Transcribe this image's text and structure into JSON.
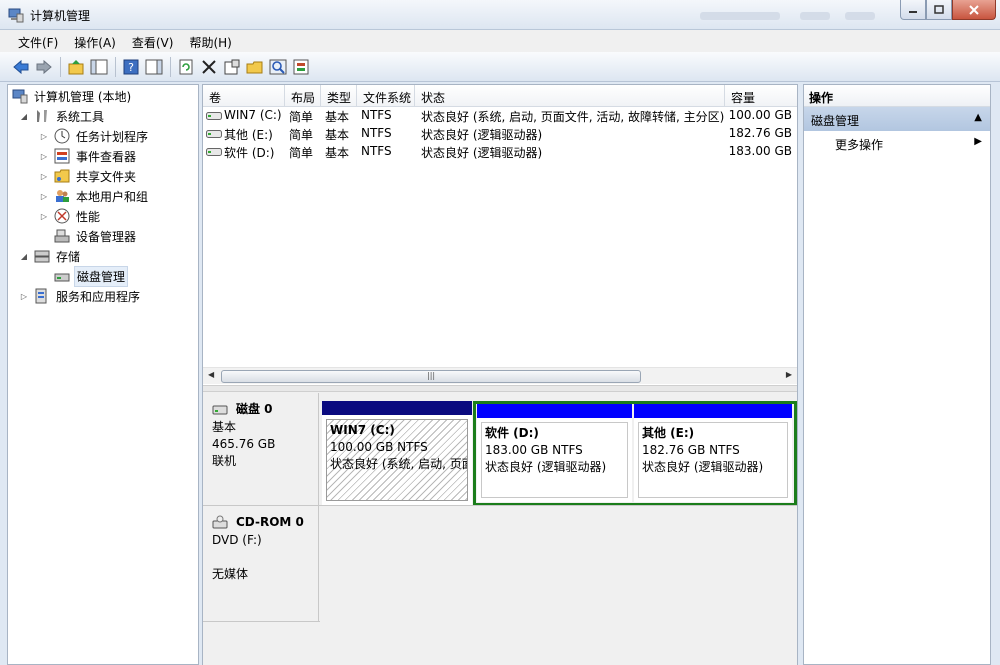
{
  "window": {
    "title": "计算机管理"
  },
  "menu": [
    "文件(F)",
    "操作(A)",
    "查看(V)",
    "帮助(H)"
  ],
  "toolbar": [
    "back-icon",
    "forward-icon",
    "up-folder-icon",
    "show-hide-tree-icon",
    "help-icon",
    "show-hide-action-icon",
    "refresh-icon",
    "delete-icon",
    "properties-icon",
    "open-icon",
    "search-icon",
    "settings-icon"
  ],
  "tree": {
    "root": "计算机管理 (本地)",
    "system_tools": "系统工具",
    "task_scheduler": "任务计划程序",
    "event_viewer": "事件查看器",
    "shared_folders": "共享文件夹",
    "local_users": "本地用户和组",
    "performance": "性能",
    "device_manager": "设备管理器",
    "storage": "存储",
    "disk_management": "磁盘管理",
    "services_apps": "服务和应用程序"
  },
  "volume_table": {
    "headers": [
      "卷",
      "布局",
      "类型",
      "文件系统",
      "状态",
      "容量"
    ],
    "rows": [
      [
        "WIN7 (C:)",
        "简单",
        "基本",
        "NTFS",
        "状态良好 (系统, 启动, 页面文件, 活动, 故障转储, 主分区)",
        "100.00 GB"
      ],
      [
        "其他 (E:)",
        "简单",
        "基本",
        "NTFS",
        "状态良好 (逻辑驱动器)",
        "182.76 GB"
      ],
      [
        "软件 (D:)",
        "简单",
        "基本",
        "NTFS",
        "状态良好 (逻辑驱动器)",
        "183.00 GB"
      ]
    ]
  },
  "disks": {
    "disk0": {
      "name": "磁盘 0",
      "type": "基本",
      "size": "465.76 GB",
      "status": "联机"
    },
    "cdrom0": {
      "name": "CD-ROM 0",
      "type": "DVD (F:)",
      "status": "无媒体"
    }
  },
  "partitions": [
    {
      "name": "WIN7  (C:)",
      "size": "100.00 GB NTFS",
      "status": "状态良好 (系统, 启动, 页面"
    },
    {
      "name": "软件   (D:)",
      "size": "183.00 GB NTFS",
      "status": "状态良好 (逻辑驱动器)"
    },
    {
      "name": "其他   (E:)",
      "size": "182.76 GB NTFS",
      "status": "状态良好 (逻辑驱动器)"
    }
  ],
  "actions": {
    "header": "操作",
    "section": "磁盘管理",
    "more": "更多操作"
  },
  "colors": {
    "primary_bar": "#0a0a7f",
    "logical_bar": "#0000ff",
    "extended_border": "#1b7d1b"
  }
}
